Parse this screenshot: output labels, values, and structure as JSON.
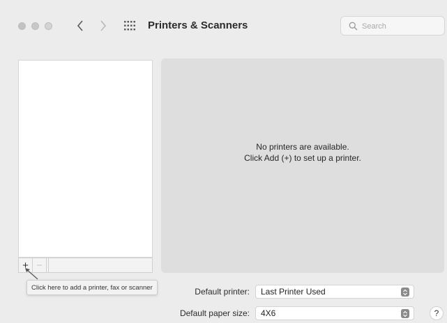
{
  "window": {
    "title": "Printers & Scanners"
  },
  "search": {
    "placeholder": "Search"
  },
  "sidebar": {
    "add_label": "+",
    "remove_label": "−"
  },
  "detail": {
    "empty_line1": "No printers are available.",
    "empty_line2": "Click Add (+) to set up a printer."
  },
  "tooltip": {
    "text": "Click here to add a printer, fax or scanner"
  },
  "settings": {
    "default_printer_label": "Default printer:",
    "default_printer_value": "Last Printer Used",
    "default_paper_label": "Default paper size:",
    "default_paper_value": "4X6"
  },
  "help": {
    "label": "?"
  },
  "icons": {
    "back": "chevron-left-icon",
    "forward": "chevron-right-icon",
    "grid": "grid-icon",
    "search": "search-icon",
    "stepper": "updown-stepper-icon",
    "pointer": "arrow-pointer-icon"
  }
}
